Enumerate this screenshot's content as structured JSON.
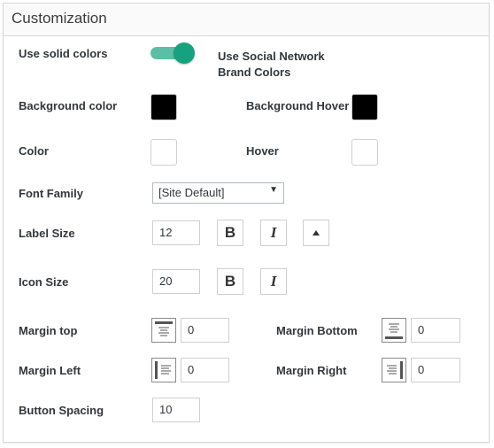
{
  "panel": {
    "title": "Customization"
  },
  "solid_colors": {
    "label": "Use solid colors",
    "enabled": true,
    "brand_label_line1": "Use Social Network",
    "brand_label_line2": "Brand Colors"
  },
  "colors": {
    "background_color_label": "Background color",
    "background_color_value": "#000000",
    "background_hover_label": "Background Hover",
    "background_hover_value": "#000000",
    "color_label": "Color",
    "color_value": "#ffffff",
    "hover_label": "Hover",
    "hover_value": "#ffffff"
  },
  "font_family": {
    "label": "Font Family",
    "selected": "[Site Default]"
  },
  "label_size": {
    "label": "Label Size",
    "value": "12",
    "bold_glyph": "B",
    "italic_glyph": "I"
  },
  "icon_size": {
    "label": "Icon Size",
    "value": "20",
    "bold_glyph": "B",
    "italic_glyph": "I"
  },
  "margins": {
    "top_label": "Margin top",
    "top_value": "0",
    "bottom_label": "Margin Bottom",
    "bottom_value": "0",
    "left_label": "Margin Left",
    "left_value": "0",
    "right_label": "Margin Right",
    "right_value": "0"
  },
  "button_spacing": {
    "label": "Button Spacing",
    "value": "10"
  },
  "theme": {
    "accent": "#17a27f",
    "accent_track": "#5bbfa6"
  }
}
